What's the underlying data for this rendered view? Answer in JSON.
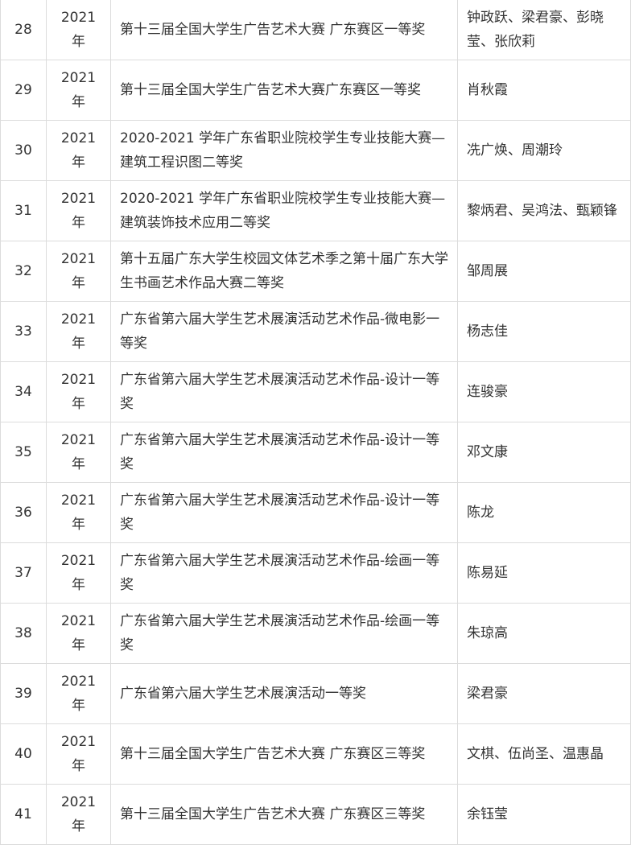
{
  "table": {
    "rows": [
      {
        "no": "28",
        "year": "2021",
        "unit": "年",
        "award": "第十三届全国大学生广告艺术大赛 广东赛区一等奖",
        "winners": "钟政跃、梁君豪、彭晓莹、张欣莉"
      },
      {
        "no": "29",
        "year": "2021",
        "unit": "年",
        "award": "第十三届全国大学生广告艺术大赛广东赛区一等奖",
        "winners": "肖秋霞"
      },
      {
        "no": "30",
        "year": "2021",
        "unit": "年",
        "award": "2020-2021 学年广东省职业院校学生专业技能大赛—建筑工程识图二等奖",
        "winners": "冼广焕、周潮玲"
      },
      {
        "no": "31",
        "year": "2021",
        "unit": "年",
        "award": "2020-2021 学年广东省职业院校学生专业技能大赛—建筑装饰技术应用二等奖",
        "winners": "黎炳君、吴鸿法、甄颖锋"
      },
      {
        "no": "32",
        "year": "2021",
        "unit": "年",
        "award": "第十五届广东大学生校园文体艺术季之第十届广东大学生书画艺术作品大赛二等奖",
        "winners": "邹周展"
      },
      {
        "no": "33",
        "year": "2021",
        "unit": "年",
        "award": "广东省第六届大学生艺术展演活动艺术作品-微电影一等奖",
        "winners": "杨志佳"
      },
      {
        "no": "34",
        "year": "2021",
        "unit": "年",
        "award": "广东省第六届大学生艺术展演活动艺术作品-设计一等奖",
        "winners": "连骏豪"
      },
      {
        "no": "35",
        "year": "2021",
        "unit": "年",
        "award": "广东省第六届大学生艺术展演活动艺术作品-设计一等奖",
        "winners": "邓文康"
      },
      {
        "no": "36",
        "year": "2021",
        "unit": "年",
        "award": "广东省第六届大学生艺术展演活动艺术作品-设计一等奖",
        "winners": "陈龙"
      },
      {
        "no": "37",
        "year": "2021",
        "unit": "年",
        "award": "广东省第六届大学生艺术展演活动艺术作品-绘画一等奖",
        "winners": "陈易延"
      },
      {
        "no": "38",
        "year": "2021",
        "unit": "年",
        "award": "广东省第六届大学生艺术展演活动艺术作品-绘画一等奖",
        "winners": "朱琼高"
      },
      {
        "no": "39",
        "year": "2021",
        "unit": "年",
        "award": "广东省第六届大学生艺术展演活动一等奖",
        "winners": "梁君豪"
      },
      {
        "no": "40",
        "year": "2021",
        "unit": "年",
        "award": "第十三届全国大学生广告艺术大赛 广东赛区三等奖",
        "winners": "文棋、伍尚圣、温惠晶"
      },
      {
        "no": "41",
        "year": "2021",
        "unit": "年",
        "award": "第十三届全国大学生广告艺术大赛 广东赛区三等奖",
        "winners": "余钰莹"
      }
    ]
  }
}
